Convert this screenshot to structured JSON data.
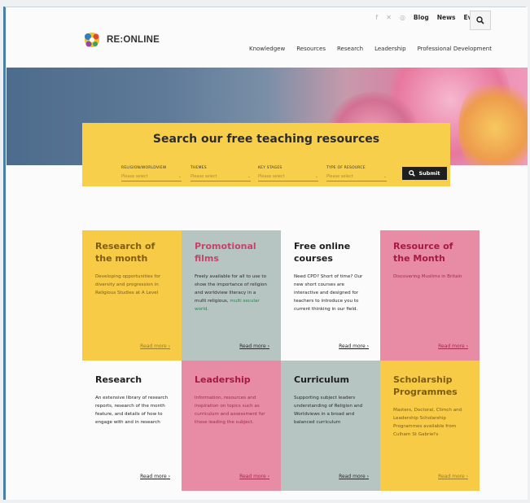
{
  "brand": {
    "name": "RE:ONLINE"
  },
  "utility_nav": [
    "Blog",
    "News",
    "Events"
  ],
  "social_icons": [
    "facebook-icon",
    "twitter-icon",
    "instagram-icon"
  ],
  "main_nav": [
    "Knowledgew",
    "Resources",
    "Research",
    "Leadership",
    "Professional Development"
  ],
  "search": {
    "title": "Search our free teaching resources",
    "filters": [
      {
        "label": "RELIGION/WORLDVIEW",
        "placeholder": "Please select"
      },
      {
        "label": "THEMES",
        "placeholder": "Please select"
      },
      {
        "label": "KEY STAGES",
        "placeholder": "Please select"
      },
      {
        "label": "TYPE OF RESOURCE",
        "placeholder": "Please select"
      }
    ],
    "submit_label": "Submit"
  },
  "cards": [
    {
      "title": "Research of the month",
      "body": "Developing opportunities for diversity and progression in Religious Studies at A Level",
      "more": "Read more",
      "color": "yellow"
    },
    {
      "title": "Promotional films",
      "body": "Freely available for all to use to show the importance of religion and worldview literacy in a multi religious,",
      "body_extra": "multi secular world.",
      "more": "Read more",
      "color": "sage"
    },
    {
      "title": "Free online courses",
      "body": "Need CPD? Short of time? Our new short courses are interactive and designed for teachers to introduce you to current thinking in our field.",
      "more": "Read more",
      "color": "white"
    },
    {
      "title": "Resource of the Month",
      "body": "Discovering Muslims in Britain",
      "more": "Read more",
      "color": "pink"
    },
    {
      "title": "Research",
      "body": "An extensive library of research reports, research of the month feature, and details of how to engage with and in research",
      "more": "Read more",
      "color": "white"
    },
    {
      "title": "Leadership",
      "body": "Information, resources and inspiration on topics such as curriculum and assessment for those leading the subject.",
      "more": "Read more",
      "color": "pink"
    },
    {
      "title": "Curriculum",
      "body": "Supporting subject leaders understanding of Religion and Worldviews in a broad and balanced curriculum",
      "more": "Read more",
      "color": "sage"
    },
    {
      "title": "Scholarship Programmes",
      "body": "Masters, Doctoral, Climch and Leadership Scholarship Programmes available from Culham St Gabriel's",
      "more": "Read more",
      "color": "yellow"
    }
  ],
  "colors": {
    "yellow": "#f7cb45",
    "sage": "#b6c5c2",
    "pink": "#e88ba5",
    "dark": "#1f1f1f"
  }
}
